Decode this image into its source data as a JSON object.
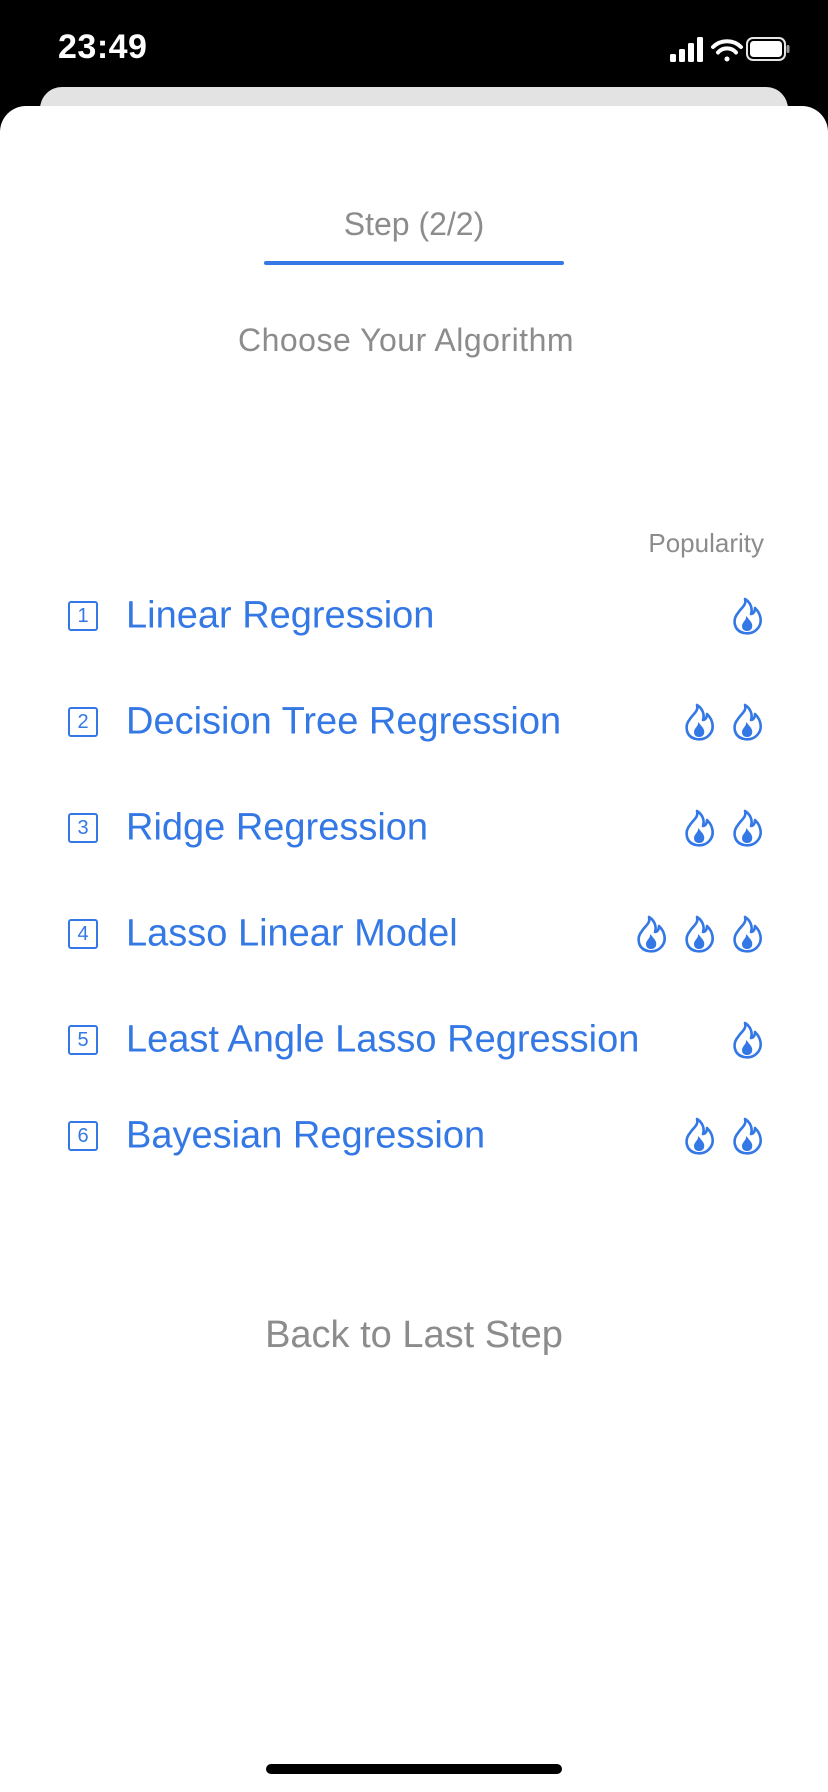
{
  "status_bar": {
    "time": "23:49"
  },
  "step": {
    "title": "Step (2/2)",
    "subtitle": "Choose Your Algorithm"
  },
  "list": {
    "popularity_header": "Popularity",
    "items": [
      {
        "number": "1",
        "label": "Linear Regression",
        "popularity": 1
      },
      {
        "number": "2",
        "label": "Decision Tree Regression",
        "popularity": 2
      },
      {
        "number": "3",
        "label": "Ridge Regression",
        "popularity": 2
      },
      {
        "number": "4",
        "label": "Lasso Linear Model",
        "popularity": 3
      },
      {
        "number": "5",
        "label": "Least Angle Lasso Regression",
        "popularity": 1
      },
      {
        "number": "6",
        "label": "Bayesian Regression",
        "popularity": 2
      }
    ]
  },
  "footer": {
    "back_label": "Back to Last Step"
  },
  "colors": {
    "accent": "#3478e5",
    "muted": "#8c8c8c",
    "background": "#ffffff"
  },
  "icons": {
    "popularity": "flame-icon",
    "index": "numbered-square-icon"
  }
}
